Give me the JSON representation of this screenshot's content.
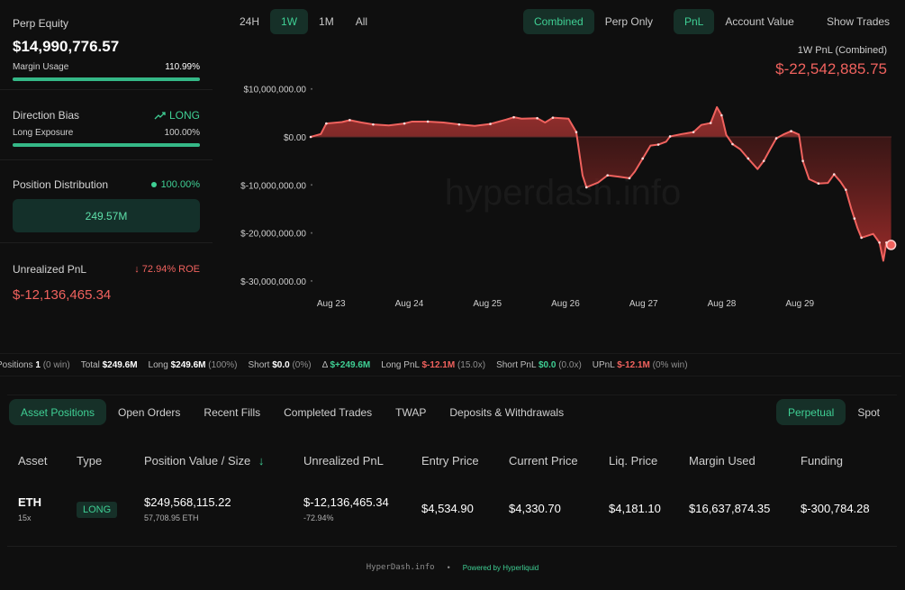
{
  "left": {
    "equity_label": "Perp Equity",
    "equity_value": "$14,990,776.57",
    "margin_label": "Margin Usage",
    "margin_value": "110.99%",
    "margin_fill": 1.0,
    "bias_label": "Direction Bias",
    "bias_icon": "trend-up-icon",
    "bias_value": "LONG",
    "long_exposure_label": "Long Exposure",
    "long_exposure_value": "100.00%",
    "long_exposure_fill": 1.0,
    "dist_label": "Position Distribution",
    "dist_value": "100.00%",
    "dist_box": "249.57M",
    "upnl_label": "Unrealized PnL",
    "roe_value": "72.94% ROE",
    "upnl_value": "$-12,136,465.34"
  },
  "toolbar": {
    "ranges": [
      "24H",
      "1W",
      "1M",
      "All"
    ],
    "range_active": "1W",
    "mode": [
      "Combined",
      "Perp Only"
    ],
    "mode_active": "Combined",
    "metric": [
      "PnL",
      "Account Value"
    ],
    "metric_active": "PnL",
    "show_trades": "Show Trades"
  },
  "chart_head": {
    "title": "1W PnL (Combined)",
    "value": "$-22,542,885.75"
  },
  "chart_data": {
    "type": "area",
    "watermark": "hyperdash.info",
    "yticks": [
      {
        "v": 10000000,
        "label": "$10,000,000.00"
      },
      {
        "v": 0,
        "label": "$0.00"
      },
      {
        "v": -10000000,
        "label": "$-10,000,000.00"
      },
      {
        "v": -20000000,
        "label": "$-20,000,000.00"
      },
      {
        "v": -30000000,
        "label": "$-30,000,000.00"
      }
    ],
    "xticks": [
      {
        "t": 0.4,
        "label": "Aug 23"
      },
      {
        "t": 1.4,
        "label": "Aug 24"
      },
      {
        "t": 2.4,
        "label": "Aug 25"
      },
      {
        "t": 3.4,
        "label": "Aug 26"
      },
      {
        "t": 4.4,
        "label": "Aug 27"
      },
      {
        "t": 5.4,
        "label": "Aug 28"
      },
      {
        "t": 6.4,
        "label": "Aug 29"
      }
    ],
    "xlim": [
      0,
      7.1
    ],
    "ylim": [
      -30000000,
      10000000
    ],
    "series": [
      {
        "color": "#f0625e",
        "points": [
          [
            0.0,
            0
          ],
          [
            0.13,
            600000
          ],
          [
            0.2,
            2800000
          ],
          [
            0.4,
            3100000
          ],
          [
            0.5,
            3500000
          ],
          [
            0.65,
            3000000
          ],
          [
            0.8,
            2600000
          ],
          [
            1.0,
            2400000
          ],
          [
            1.2,
            2800000
          ],
          [
            1.3,
            3200000
          ],
          [
            1.5,
            3200000
          ],
          [
            1.7,
            3000000
          ],
          [
            1.9,
            2600000
          ],
          [
            2.1,
            2300000
          ],
          [
            2.3,
            2700000
          ],
          [
            2.5,
            3600000
          ],
          [
            2.6,
            4100000
          ],
          [
            2.7,
            3800000
          ],
          [
            2.9,
            3900000
          ],
          [
            3.0,
            3000000
          ],
          [
            3.1,
            4000000
          ],
          [
            3.3,
            3800000
          ],
          [
            3.4,
            1000000
          ],
          [
            3.48,
            -8000000
          ],
          [
            3.53,
            -10500000
          ],
          [
            3.68,
            -9500000
          ],
          [
            3.8,
            -8000000
          ],
          [
            3.95,
            -8300000
          ],
          [
            4.08,
            -8600000
          ],
          [
            4.15,
            -7200000
          ],
          [
            4.25,
            -4500000
          ],
          [
            4.35,
            -1800000
          ],
          [
            4.45,
            -1600000
          ],
          [
            4.55,
            -1000000
          ],
          [
            4.6,
            100000
          ],
          [
            4.75,
            600000
          ],
          [
            4.9,
            1000000
          ],
          [
            5.0,
            2500000
          ],
          [
            5.12,
            2900000
          ],
          [
            5.2,
            6200000
          ],
          [
            5.26,
            4500000
          ],
          [
            5.32,
            400000
          ],
          [
            5.4,
            -1500000
          ],
          [
            5.5,
            -2600000
          ],
          [
            5.6,
            -4500000
          ],
          [
            5.72,
            -6700000
          ],
          [
            5.8,
            -5000000
          ],
          [
            5.88,
            -2600000
          ],
          [
            5.96,
            -300000
          ],
          [
            6.05,
            500000
          ],
          [
            6.15,
            1200000
          ],
          [
            6.25,
            500000
          ],
          [
            6.3,
            -5000000
          ],
          [
            6.38,
            -8800000
          ],
          [
            6.5,
            -9700000
          ],
          [
            6.62,
            -9600000
          ],
          [
            6.7,
            -7800000
          ],
          [
            6.78,
            -9300000
          ],
          [
            6.85,
            -11000000
          ],
          [
            6.92,
            -15000000
          ],
          [
            6.96,
            -17000000
          ],
          [
            7.0,
            -19000000
          ],
          [
            7.05,
            -21000000
          ],
          [
            7.2,
            -20200000
          ],
          [
            7.28,
            -22000000
          ],
          [
            7.33,
            -25800000
          ],
          [
            7.37,
            -22000000
          ],
          [
            7.43,
            -22500000
          ]
        ]
      }
    ],
    "end_marker": -22500000
  },
  "stats": [
    {
      "label": "Positions",
      "value": "1",
      "sub": "(0 win)"
    },
    {
      "label": "Total",
      "value": "$249.6M",
      "sub": ""
    },
    {
      "label": "Long",
      "value": "$249.6M",
      "sub": "(100%)"
    },
    {
      "label": "Short",
      "value": "$0.0",
      "sub": "(0%)"
    },
    {
      "label": "Δ",
      "value": "$+249.6M",
      "sub": "",
      "color": "green"
    },
    {
      "label": "Long PnL",
      "value": "$-12.1M",
      "sub": "(15.0x)",
      "color": "red"
    },
    {
      "label": "Short PnL",
      "value": "$0.0",
      "sub": "(0.0x)",
      "color": "green"
    },
    {
      "label": "UPnL",
      "value": "$-12.1M",
      "sub": "(0% win)",
      "color": "red"
    }
  ],
  "tabs": [
    "Asset Positions",
    "Open Orders",
    "Recent Fills",
    "Completed Trades",
    "TWAP",
    "Deposits & Withdrawals"
  ],
  "tab_active": "Asset Positions",
  "market_tabs": [
    "Perpetual",
    "Spot"
  ],
  "market_active": "Perpetual",
  "table": {
    "headers": [
      "Asset",
      "Type",
      "Position Value / Size",
      "Unrealized PnL",
      "Entry Price",
      "Current Price",
      "Liq. Price",
      "Margin Used",
      "Funding"
    ],
    "sort_icon": "arrow-down-icon",
    "row": {
      "asset": "ETH",
      "leverage": "15x",
      "type": "LONG",
      "value": "$249,568,115.22",
      "size": "57,708.95 ETH",
      "upnl": "$-12,136,465.34",
      "upnl_pct": "-72.94%",
      "entry": "$4,534.90",
      "current": "$4,330.70",
      "liq": "$4,181.10",
      "margin": "$16,637,874.35",
      "funding": "$-300,784.28"
    }
  },
  "footer": {
    "site": "HyperDash.info",
    "sep": "•",
    "powered": "Powered by Hyperliquid"
  }
}
